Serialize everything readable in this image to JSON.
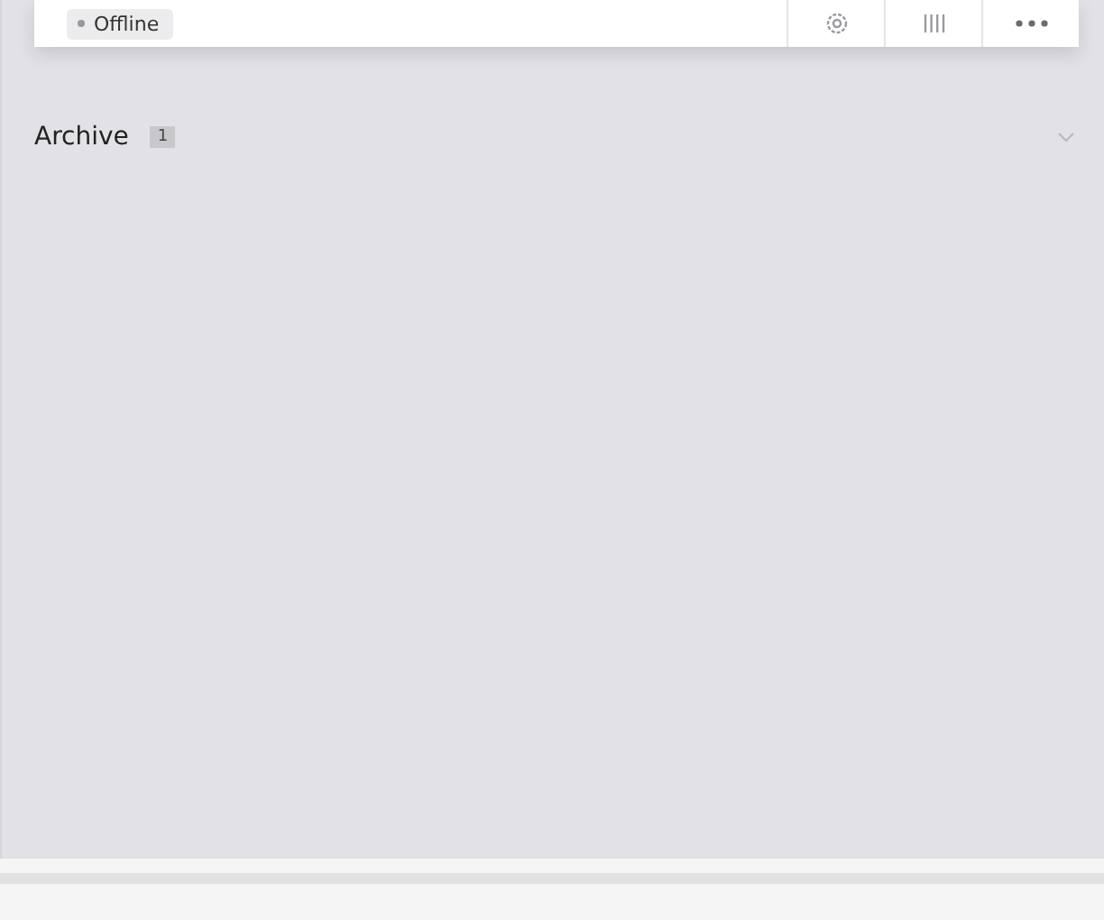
{
  "card": {
    "status_badge": "Offline",
    "actions": [
      {
        "kind": "settings"
      },
      {
        "kind": "columns"
      },
      {
        "kind": "more"
      }
    ]
  },
  "sections": [
    {
      "title": "Archive",
      "count": "1",
      "expanded": false
    }
  ]
}
